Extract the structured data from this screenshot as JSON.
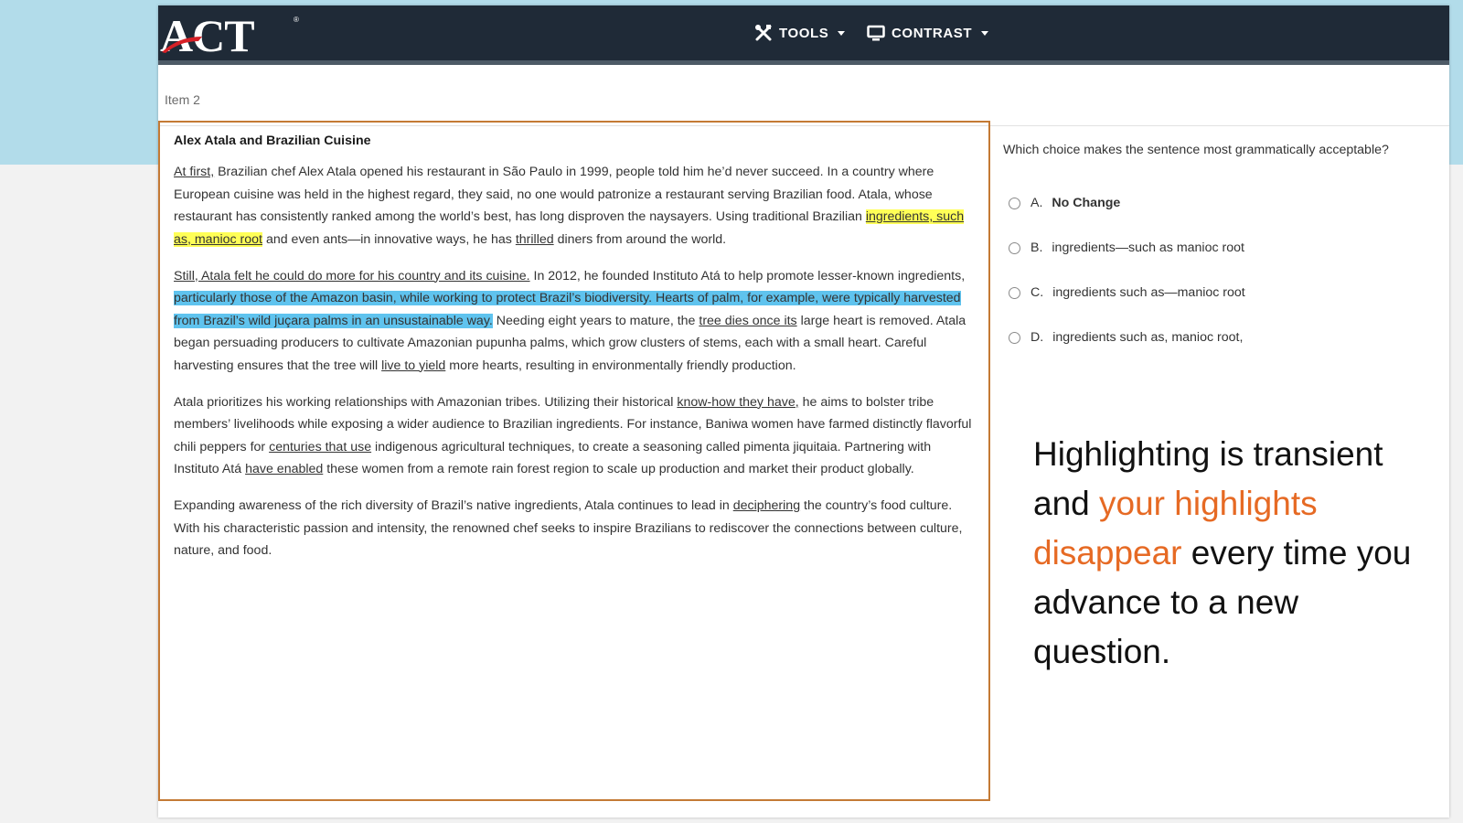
{
  "header": {
    "logo_text": "ACT",
    "tools_label": "TOOLS",
    "contrast_label": "CONTRAST"
  },
  "item_label": "Item 2",
  "passage": {
    "title": "Alex Atala and Brazilian Cuisine",
    "p1": {
      "u1": "At first,",
      "t1": " Brazilian chef Alex Atala opened his restaurant in São Paulo in 1999, people told him he’d never succeed. In a country where European cuisine was held in the highest regard, they said, no one would patronize a restaurant serving Brazilian food. Atala, whose restaurant has consistently ranked among the world’s best, has long disproven the naysayers. Using traditional Brazilian ",
      "hl_u": "ingredients, such as, manioc root",
      "t2": " and even ants—in innovative ways, he has ",
      "u2": "thrilled",
      "t3": " diners from around the world."
    },
    "p2": {
      "u1": "Still, Atala felt he could do more for his country and its cuisine.",
      "t1": " In 2012, he founded Instituto Atá to help promote lesser-known ingredients, ",
      "hl": "particularly those of the Amazon basin, while working to protect Brazil’s biodiversity. Hearts of palm, for example, were typically harvested from Brazil’s wild juçara palms in an unsustainable way.",
      "t2": " Needing eight years to mature, the ",
      "u2": "tree dies once its",
      "t3": " large heart is removed. Atala began persuading producers to cultivate Amazonian pupunha palms, which grow clusters of stems, each with a small heart. Careful harvesting ensures that the tree will ",
      "u3": "live to yield",
      "t4": " more hearts, resulting in environmentally friendly production."
    },
    "p3": {
      "t1": "Atala prioritizes his working relationships with Amazonian tribes. Utilizing their historical ",
      "u1": "know-how they have,",
      "t2": " he aims to bolster tribe members’ livelihoods while exposing a wider audience to Brazilian ingredients. For instance, Baniwa women have farmed distinctly flavorful chili peppers for ",
      "u2": "centuries that use",
      "t3": " indigenous agricultural techniques, to create a seasoning called pimenta jiquitaia. Partnering with Instituto Atá ",
      "u3": "have enabled",
      "t4": " these women from a remote rain forest region to scale up production and market their product globally."
    },
    "p4": {
      "t1": "Expanding awareness of the rich diversity of Brazil’s native ingredients, Atala continues to lead in ",
      "u1": "deciphering",
      "t2": " the country’s food culture. With his characteristic passion and intensity, the renowned chef seeks to inspire Brazilians to rediscover the connections between culture, nature, and food."
    }
  },
  "question": {
    "prompt": "Which choice makes the sentence most grammatically acceptable?",
    "choices": [
      {
        "letter": "A.",
        "text": "No Change"
      },
      {
        "letter": "B.",
        "text": "ingredients—such as manioc root"
      },
      {
        "letter": "C.",
        "text": "ingredients such as—manioc root"
      },
      {
        "letter": "D.",
        "text": "ingredients such as, manioc root,"
      }
    ]
  },
  "caption": {
    "part1": "Highlighting is transient and ",
    "part2": "your highlights disappear",
    "part3": " every time you advance to a new question."
  },
  "colors": {
    "header_bg": "#1f2a37",
    "passage_border": "#c47a35",
    "highlight_yellow": "#ffff57",
    "highlight_blue": "#5fc3ee",
    "caption_accent": "#e66a24",
    "background_top": "#b2dcea"
  },
  "icons": {
    "tools": "tools-icon",
    "contrast": "monitor-icon"
  }
}
